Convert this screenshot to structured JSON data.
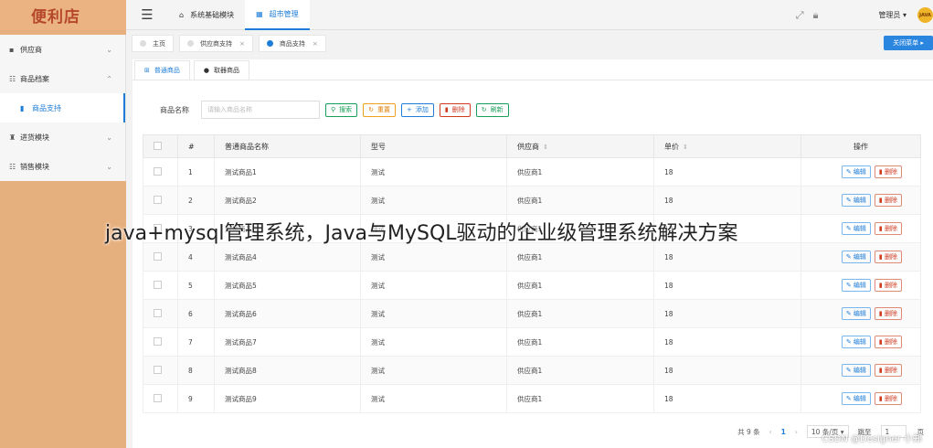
{
  "app": {
    "logo_text": "便利店"
  },
  "sidebar": {
    "items": [
      {
        "icon": "box-icon",
        "label": "供应商",
        "arrow": "⌄"
      },
      {
        "icon": "grid-icon",
        "label": "商品档案",
        "arrow": "⌃"
      },
      {
        "icon": "bookmark-icon",
        "label": "商品支持",
        "sub": true
      },
      {
        "icon": "cart-icon",
        "label": "进货模块",
        "arrow": "⌄"
      },
      {
        "icon": "grid-icon",
        "label": "销售模块",
        "arrow": "⌄"
      }
    ]
  },
  "topbar": {
    "tabs": [
      {
        "icon": "home-icon",
        "label": "系统基础模块"
      },
      {
        "icon": "grid-icon",
        "label": "超市管理"
      }
    ],
    "user_name": "管理员",
    "user_caret": "▾",
    "avatar_text": "JAVA"
  },
  "page_tabs": [
    {
      "label": "主页"
    },
    {
      "label": "供应商支持",
      "close": "×"
    },
    {
      "label": "商品支持",
      "close": "×"
    }
  ],
  "close_menu_label": "关闭菜单 ▸",
  "subtabs": [
    {
      "icon": "windows-icon",
      "label": "普通商品"
    },
    {
      "icon": "apple-icon",
      "label": "取器商品"
    }
  ],
  "search": {
    "label": "商品名称",
    "placeholder": "请输入商品名称",
    "buttons": {
      "search": "搜索",
      "reset": "重置",
      "add": "添加",
      "delete": "删除",
      "refresh": "刷新"
    }
  },
  "table": {
    "headers": {
      "index": "#",
      "name": "普通商品名称",
      "model": "型号",
      "supplier": "供应商",
      "price": "单价",
      "actions": "操作"
    },
    "rows": [
      {
        "index": "1",
        "name": "测试商品1",
        "model": "测试",
        "supplier": "供应商1",
        "price": "18"
      },
      {
        "index": "2",
        "name": "测试商品2",
        "model": "测试",
        "supplier": "供应商1",
        "price": "18"
      },
      {
        "index": "3",
        "name": "测试商品3",
        "model": "测试",
        "supplier": "供应商1",
        "price": "18"
      },
      {
        "index": "4",
        "name": "测试商品4",
        "model": "测试",
        "supplier": "供应商1",
        "price": "18"
      },
      {
        "index": "5",
        "name": "测试商品5",
        "model": "测试",
        "supplier": "供应商1",
        "price": "18"
      },
      {
        "index": "6",
        "name": "测试商品6",
        "model": "测试",
        "supplier": "供应商1",
        "price": "18"
      },
      {
        "index": "7",
        "name": "测试商品7",
        "model": "测试",
        "supplier": "供应商1",
        "price": "18"
      },
      {
        "index": "8",
        "name": "测试商品8",
        "model": "测试",
        "supplier": "供应商1",
        "price": "18"
      },
      {
        "index": "9",
        "name": "测试商品9",
        "model": "测试",
        "supplier": "供应商1",
        "price": "18"
      }
    ],
    "edit_label": "编辑",
    "delete_label": "删除"
  },
  "pager": {
    "total": "共 9 条",
    "prev": "‹",
    "page": "1",
    "next": "›",
    "page_size": "10 条/页 ▾",
    "goto": "跳至",
    "goto_value": "1",
    "page_suffix": "页"
  },
  "overlay_title": "java+mysql管理系统，Java与MySQL驱动的企业级管理系统解决方案",
  "credit": "CSDN @Designer 小郑",
  "colors": {
    "accent": "#1e7dd8",
    "sidebar": "#e6b07e",
    "danger": "#d03b20",
    "success": "#18a058"
  }
}
